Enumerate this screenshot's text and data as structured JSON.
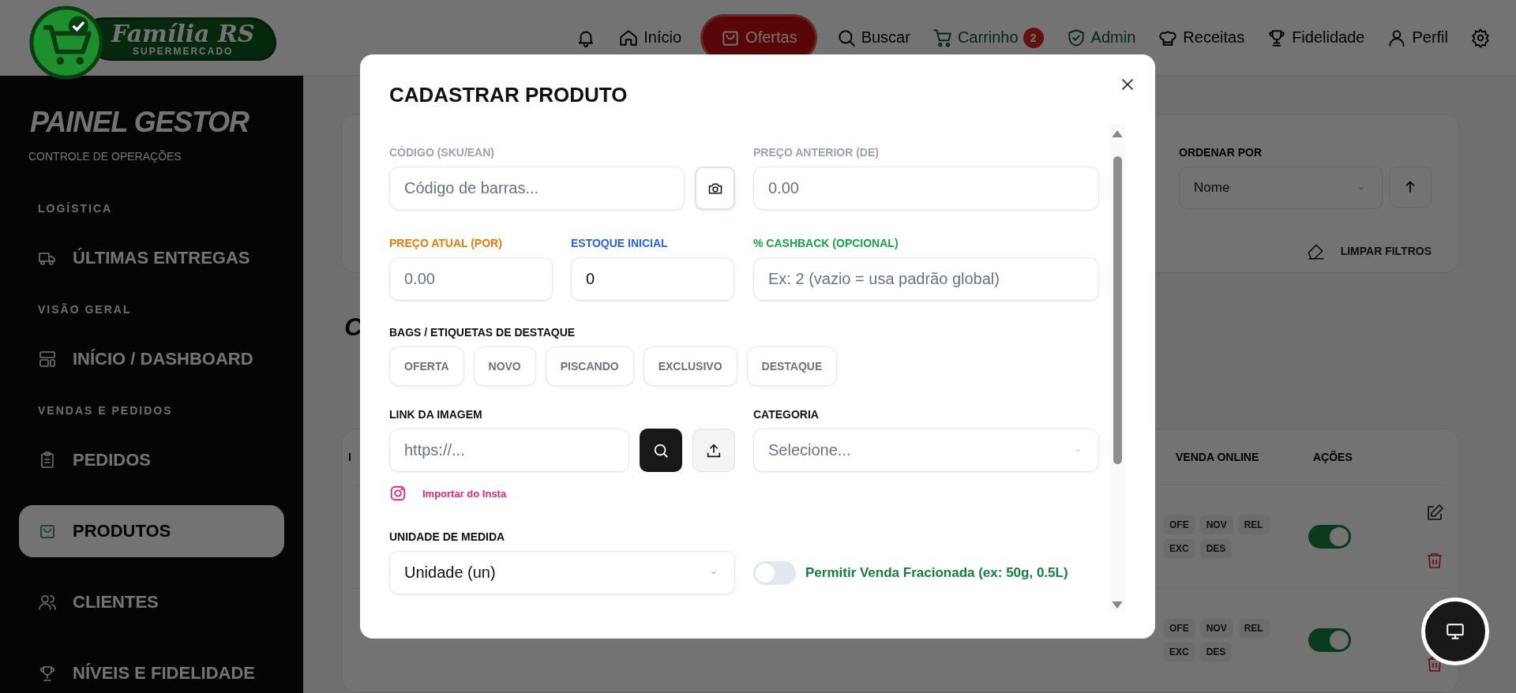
{
  "header": {
    "logo": {
      "title": "Família RS",
      "subtitle": "SUPERMERCADO"
    },
    "nav": [
      {
        "kind": "icon",
        "selected": false
      },
      {
        "kind": "link",
        "label": "Início",
        "selected": false
      },
      {
        "kind": "link",
        "label": "Ofertas",
        "selected": true
      },
      {
        "kind": "link",
        "label": "Buscar",
        "selected": false
      },
      {
        "kind": "accent",
        "label": "Carrinho",
        "badge": "2",
        "selected": false
      },
      {
        "kind": "accent",
        "label": "Admin",
        "selected": false
      },
      {
        "kind": "link",
        "label": "Receitas",
        "selected": false
      },
      {
        "kind": "link",
        "label": "Fidelidade",
        "selected": false
      },
      {
        "kind": "link",
        "label": "Perfil",
        "selected": false
      },
      {
        "kind": "icon",
        "selected": false
      }
    ]
  },
  "sidebar": {
    "title": "PAINEL GESTOR",
    "subtitle": "CONTROLE DE OPERAÇÕES",
    "sections": [
      {
        "heading": "LOGÍSTICA",
        "items": [
          {
            "label": "ÚLTIMAS ENTREGAS",
            "selected": false
          }
        ]
      },
      {
        "heading": "VISÃO GERAL",
        "items": [
          {
            "label": "INÍCIO / DASHBOARD",
            "selected": false
          }
        ]
      },
      {
        "heading": "VENDAS E PEDIDOS",
        "items": [
          {
            "label": "PEDIDOS",
            "selected": false
          },
          {
            "label": "PRODUTOS",
            "selected": true
          },
          {
            "label": "CLIENTES",
            "selected": false
          },
          {
            "label": "NÍVEIS E FIDELIDADE",
            "selected": false
          }
        ]
      }
    ]
  },
  "filters": {
    "sort_label": "ORDENAR POR",
    "sort_value": "Nome",
    "clear_label": "LIMPAR FILTROS"
  },
  "heading": "C",
  "table": {
    "columns": [
      "I",
      "VENDA ONLINE",
      "AÇÕES"
    ],
    "rows": [
      {
        "tags": [
          "OFE",
          "NOV",
          "REL",
          "EXC",
          "DES"
        ],
        "online": true
      },
      {
        "tags": [
          "OFE",
          "NOV",
          "REL",
          "EXC",
          "DES"
        ],
        "online": true
      }
    ]
  },
  "modal": {
    "title": "CADASTRAR PRODUTO",
    "code": {
      "label": "CÓDIGO (SKU/EAN)",
      "placeholder": "Código de barras..."
    },
    "old_price": {
      "label": "PREÇO ANTERIOR (DE)",
      "placeholder": "0.00"
    },
    "price": {
      "label": "PREÇO ATUAL (POR)",
      "placeholder": "0.00"
    },
    "stock": {
      "label": "ESTOQUE INICIAL",
      "value": "0"
    },
    "cashback": {
      "label": "% CASHBACK (OPCIONAL)",
      "placeholder": "Ex: 2 (vazio = usa padrão global)"
    },
    "badges": {
      "label": "BAGS / ETIQUETAS DE DESTAQUE",
      "items": [
        {
          "label": "OFERTA",
          "selected": false
        },
        {
          "label": "NOVO",
          "selected": false
        },
        {
          "label": "PISCANDO",
          "selected": false
        },
        {
          "label": "EXCLUSIVO",
          "selected": false
        },
        {
          "label": "DESTAQUE",
          "selected": false
        }
      ]
    },
    "image_link": {
      "label": "LINK DA IMAGEM",
      "placeholder": "https://...",
      "instagram_link": "Importar do Insta"
    },
    "category": {
      "label": "CATEGORIA",
      "placeholder": "Selecione..."
    },
    "unit": {
      "label": "UNIDADE DE MEDIDA",
      "value": "Unidade (un)"
    },
    "fractional": {
      "label": "Permitir Venda Fracionada (ex: 50g, 0.5L)",
      "on": false
    }
  }
}
